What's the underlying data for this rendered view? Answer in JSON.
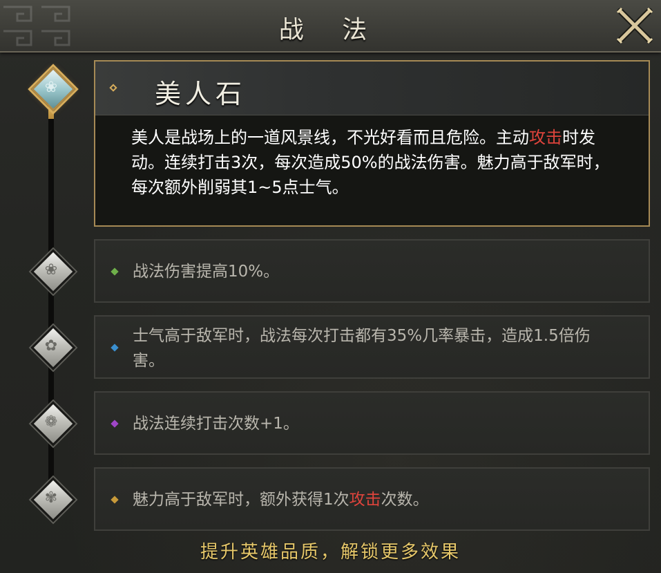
{
  "window": {
    "title": "战 法",
    "close_icon": "close-x-icon"
  },
  "skill": {
    "name": "美人石",
    "description_parts": [
      "美人是战场上的一道风景线，不光好看而且危险。主动",
      "攻击",
      "时发动。连续打击3次，每次造成50%的战法伤害。魅力高于敌军时，每次额外削弱其1~5点士气。"
    ],
    "highlight_color": "#e0443c"
  },
  "upgrades": [
    {
      "bullet_color": "#6fb04a",
      "text": "战法伤害提高10%。"
    },
    {
      "bullet_color": "#3a8fd0",
      "text": "士气高于敌军时，战法每次打击都有35%几率暴击，造成1.5倍伤害。"
    },
    {
      "bullet_color": "#a046c8",
      "text": "战法连续打击次数+1。"
    },
    {
      "bullet_color": "#c89a3a",
      "text_parts": [
        "魅力高于敌军时，额外获得1次",
        "攻击",
        "次数。"
      ]
    }
  ],
  "footer": {
    "hint": "提升英雄品质，解锁更多效果"
  },
  "colors": {
    "accent_gold": "#d8ae5c",
    "footer_yellow": "#e7c86a"
  }
}
